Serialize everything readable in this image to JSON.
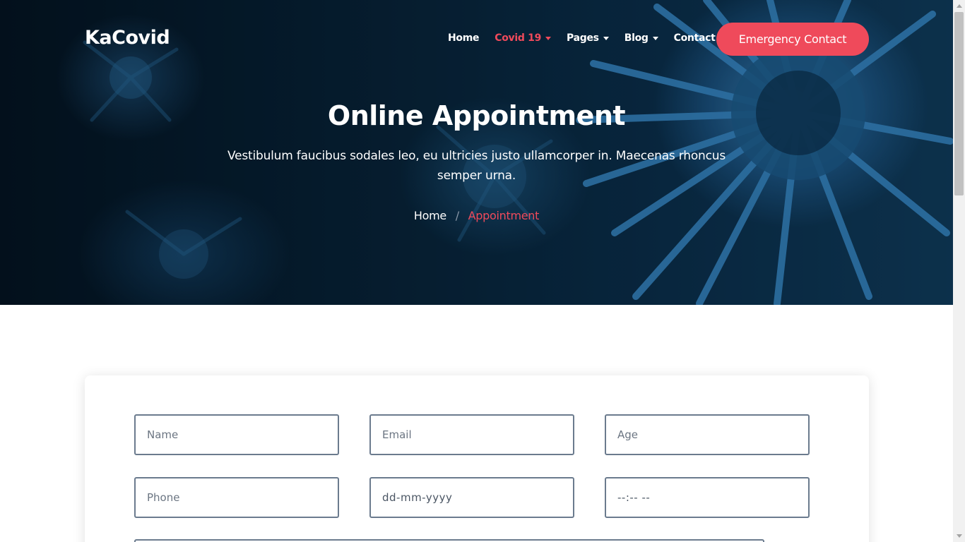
{
  "brand": "KaCovid",
  "nav": {
    "items": [
      {
        "label": "Home",
        "dropdown": false,
        "active": false
      },
      {
        "label": "Covid 19",
        "dropdown": true,
        "active": true
      },
      {
        "label": "Pages",
        "dropdown": true,
        "active": false
      },
      {
        "label": "Blog",
        "dropdown": true,
        "active": false
      },
      {
        "label": "Contact",
        "dropdown": false,
        "active": false
      }
    ],
    "cta": "Emergency Contact"
  },
  "hero": {
    "title": "Online Appointment",
    "subtitle": "Vestibulum faucibus sodales leo, eu ultricies justo ullamcorper in. Maecenas rhoncus semper urna.",
    "breadcrumb": {
      "home": "Home",
      "separator": "/",
      "current": "Appointment"
    }
  },
  "form": {
    "name_placeholder": "Name",
    "email_placeholder": "Email",
    "age_placeholder": "Age",
    "phone_placeholder": "Phone",
    "date_value": "dd-mm-yyyy",
    "time_value": "--:-- --"
  },
  "colors": {
    "accent": "#ef4a5b",
    "hero_dark": "#04121f",
    "field_border": "#6b7b8e"
  }
}
